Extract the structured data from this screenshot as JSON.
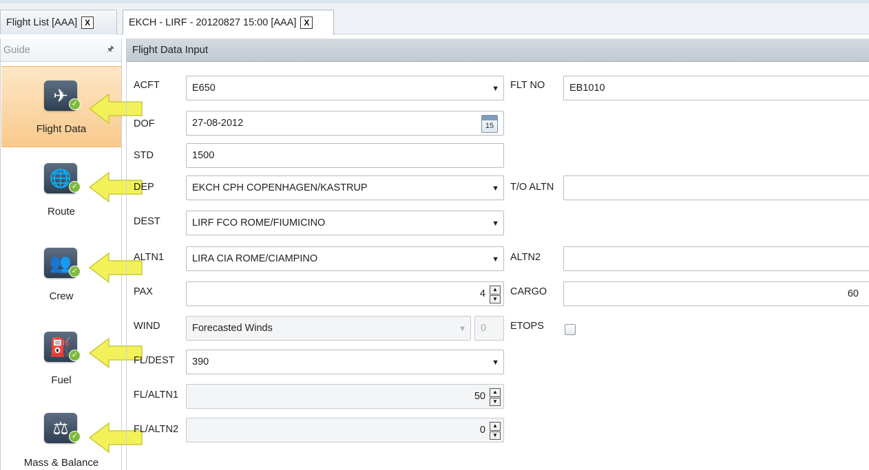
{
  "tabs": [
    {
      "label": "Flight List [AAA]",
      "close": "X"
    },
    {
      "label": "EKCH - LIRF - 20120827 15:00 [AAA]",
      "close": "X"
    }
  ],
  "guide": {
    "title": "Guide",
    "pin": "🖈",
    "items": [
      {
        "label": "Flight Data",
        "icon": "airplane-icon",
        "glyph": "✈"
      },
      {
        "label": "Route",
        "icon": "globe-icon",
        "glyph": "🌐"
      },
      {
        "label": "Crew",
        "icon": "crew-icon",
        "glyph": "👥"
      },
      {
        "label": "Fuel",
        "icon": "fuel-nozzle-icon",
        "glyph": "⛽"
      },
      {
        "label": "Mass & Balance",
        "icon": "mass-balance-icon",
        "glyph": "⚖"
      }
    ]
  },
  "main": {
    "title": "Flight Data Input",
    "labels": {
      "acft": "ACFT",
      "dof": "DOF",
      "std": "STD",
      "dep": "DEP",
      "dest": "DEST",
      "altn1": "ALTN1",
      "pax": "PAX",
      "wind": "WIND",
      "fl_dest": "FL/DEST",
      "fl_altn1": "FL/ALTN1",
      "fl_altn2": "FL/ALTN2",
      "flt_no": "FLT NO",
      "to_altn": "T/O ALTN",
      "altn2": "ALTN2",
      "cargo": "CARGO",
      "etops": "ETOPS"
    },
    "values": {
      "acft": "E650",
      "dof": "27-08-2012",
      "dof_calendar_day": "15",
      "std": "1500",
      "dep": "EKCH CPH COPENHAGEN/KASTRUP",
      "dest": "LIRF FCO ROME/FIUMICINO",
      "altn1": "LIRA CIA ROME/CIAMPINO",
      "pax": "4",
      "wind": "Forecasted Winds",
      "wind_value": "0",
      "fl_dest": "390",
      "fl_altn1": "50",
      "fl_altn2": "0",
      "flt_no": "EB1010",
      "to_altn": "",
      "altn2": "",
      "cargo": "60",
      "etops_checked": false
    },
    "glyphs": {
      "dropdown": "▼",
      "spin_up": "▲",
      "spin_down": "▼"
    }
  },
  "colors": {
    "selected_item": "#f9c98b",
    "check_badge": "#7dbb3c",
    "arrow_fill": "#f2f15a",
    "header_bar": "#c8ced5"
  }
}
